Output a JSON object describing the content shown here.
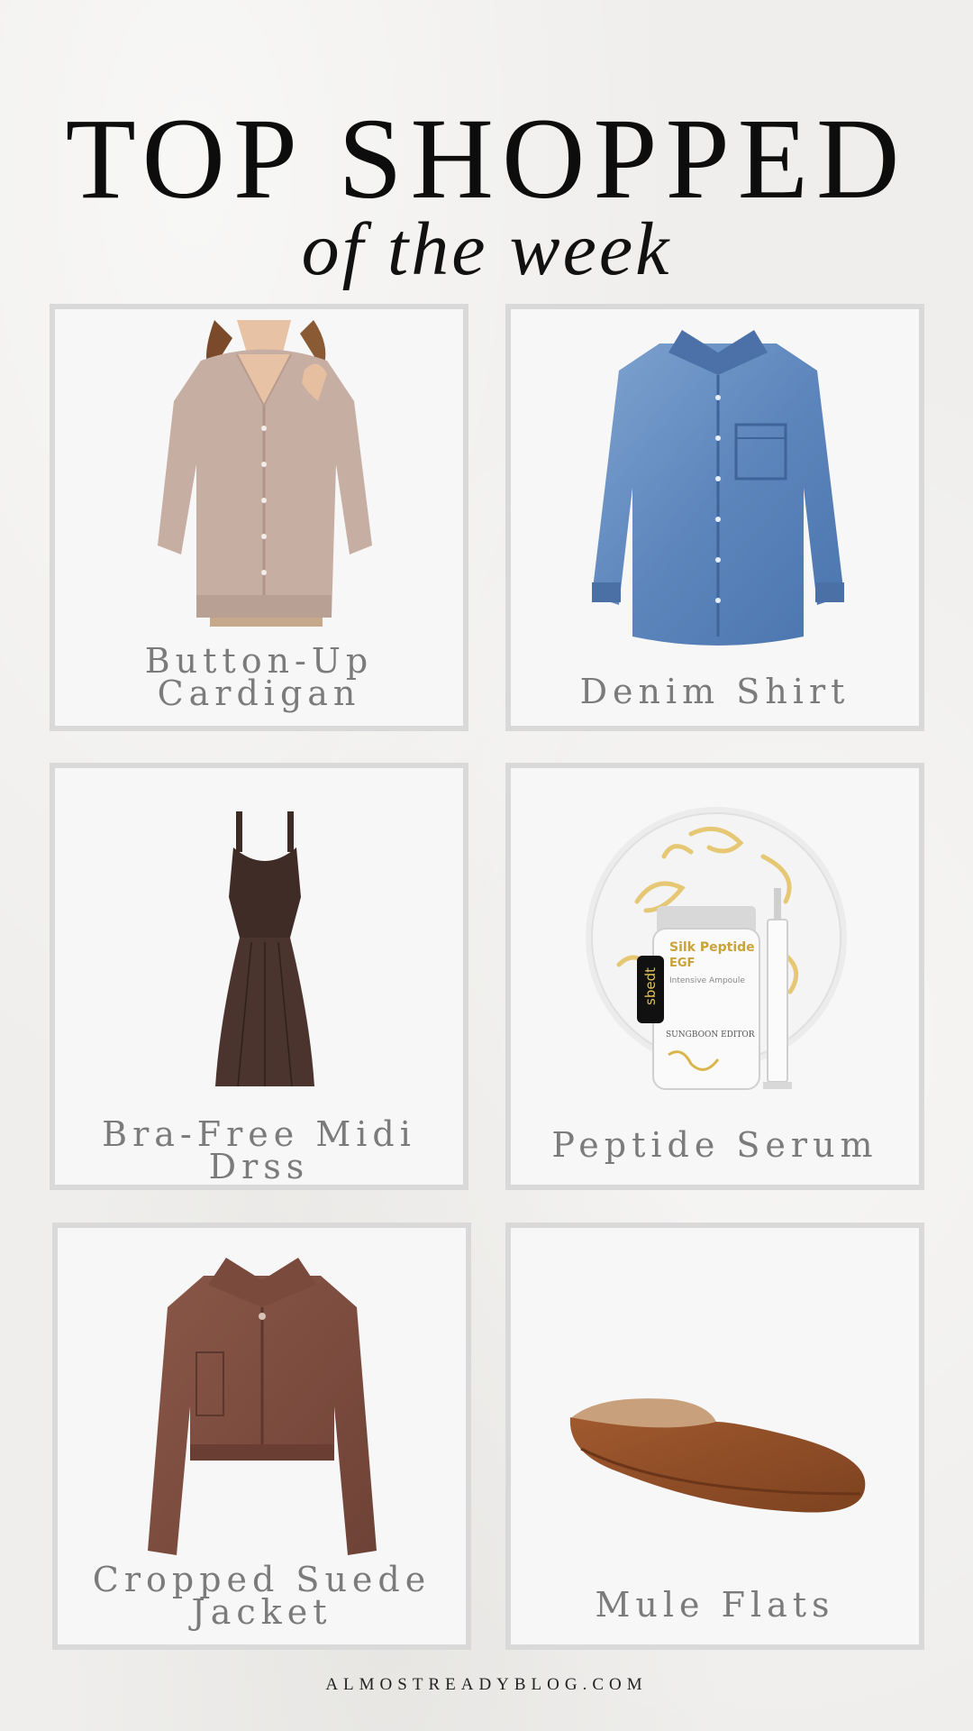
{
  "header": {
    "title": "TOP SHOPPED",
    "subtitle": "of the week"
  },
  "products": [
    {
      "name": "Button-Up Cardigan",
      "label_line1": "Button-Up",
      "label_line2": "Cardigan",
      "icon": "cardigan-image"
    },
    {
      "name": "Denim Shirt",
      "label_line1": "Denim Shirt",
      "icon": "denim-shirt-image"
    },
    {
      "name": "Bra-Free Midi Drss",
      "label_line1": "Bra-Free Midi",
      "label_line2": "Drss",
      "icon": "midi-dress-image"
    },
    {
      "name": "Peptide Serum",
      "label_line1": "Peptide Serum",
      "icon": "serum-bottle-image",
      "bottle_text": {
        "badge": "sbedt",
        "product": "Silk Peptide",
        "sub": "EGF",
        "type": "Intensive Ampoule",
        "brand": "SUNGBOON EDITOR"
      }
    },
    {
      "name": "Cropped Suede Jacket",
      "label_line1": "Cropped Suede",
      "label_line2": "Jacket",
      "icon": "suede-jacket-image"
    },
    {
      "name": "Mule Flats",
      "label_line1": "Mule Flats",
      "icon": "mule-flat-image"
    }
  ],
  "footer": {
    "site": "ALMOSTREADYBLOG.COM"
  },
  "colors": {
    "background": "#efeeec",
    "card": "#f7f7f7",
    "card_border": "#d9d9d9",
    "label": "#7b7b7b",
    "title": "#0d0d0d"
  }
}
